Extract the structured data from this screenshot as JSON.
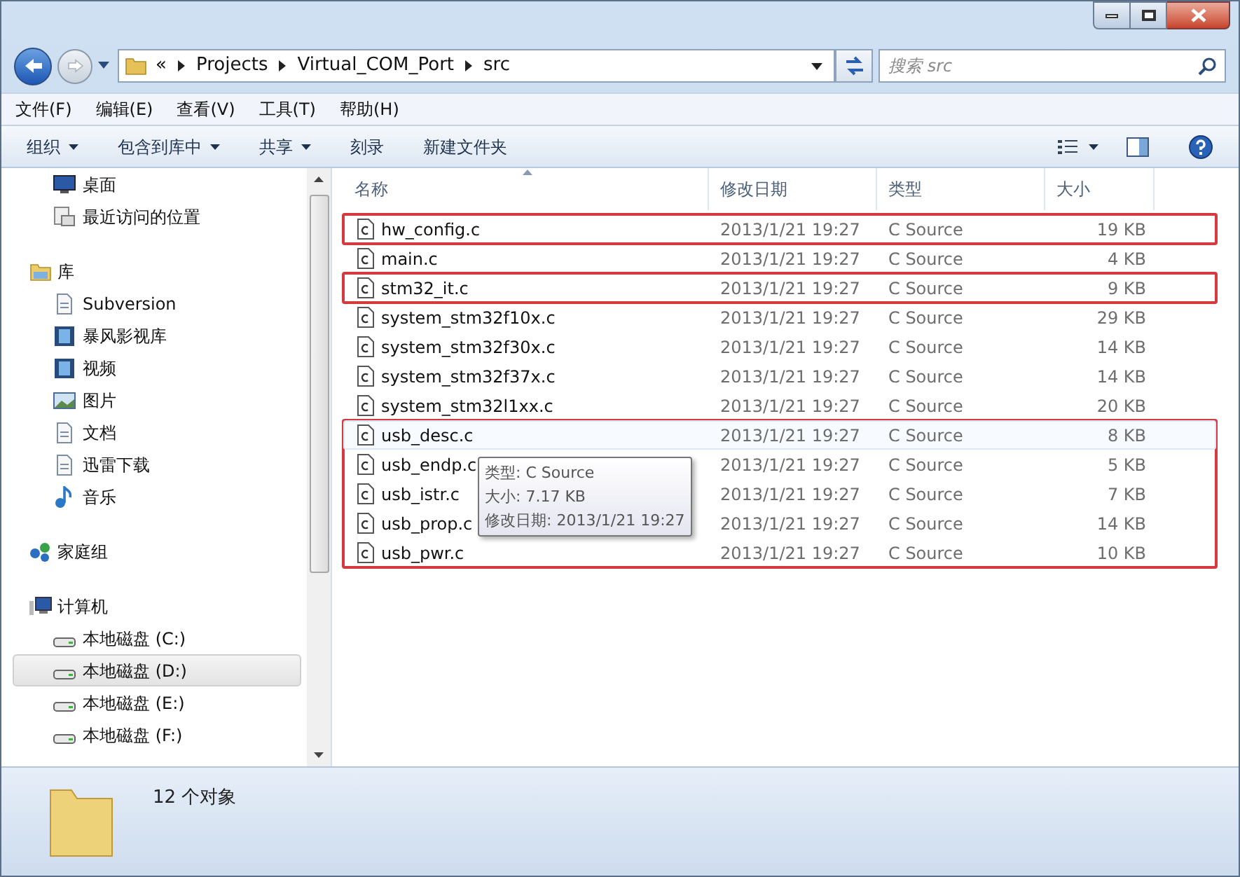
{
  "address_bar": {
    "breadcrumbs": [
      "«",
      "Projects",
      "Virtual_COM_Port",
      "src"
    ]
  },
  "search": {
    "placeholder": "搜索 src"
  },
  "menu": [
    "文件(F)",
    "编辑(E)",
    "查看(V)",
    "工具(T)",
    "帮助(H)"
  ],
  "toolbar": [
    {
      "label": "组织",
      "dropdown": true
    },
    {
      "label": "包含到库中",
      "dropdown": true
    },
    {
      "label": "共享",
      "dropdown": true
    },
    {
      "label": "刻录",
      "dropdown": false
    },
    {
      "label": "新建文件夹",
      "dropdown": false
    }
  ],
  "nav": [
    {
      "children": [
        {
          "label": "桌面",
          "kind": "desktop",
          "selected": false
        },
        {
          "label": "最近访问的位置",
          "kind": "recent",
          "selected": false
        }
      ]
    },
    {
      "label": "库",
      "kind": "library",
      "children": [
        {
          "label": "Subversion",
          "kind": "doc",
          "selected": false
        },
        {
          "label": "暴风影视库",
          "kind": "video",
          "selected": false
        },
        {
          "label": "视频",
          "kind": "video",
          "selected": false
        },
        {
          "label": "图片",
          "kind": "picture",
          "selected": false
        },
        {
          "label": "文档",
          "kind": "doc",
          "selected": false
        },
        {
          "label": "迅雷下载",
          "kind": "doc",
          "selected": false
        },
        {
          "label": "音乐",
          "kind": "music",
          "selected": false
        }
      ]
    },
    {
      "label": "家庭组",
      "kind": "homegroup"
    },
    {
      "label": "计算机",
      "kind": "computer",
      "children": [
        {
          "label": "本地磁盘 (C:)",
          "kind": "drive",
          "selected": false
        },
        {
          "label": "本地磁盘 (D:)",
          "kind": "drive",
          "selected": true
        },
        {
          "label": "本地磁盘 (E:)",
          "kind": "drive",
          "selected": false
        },
        {
          "label": "本地磁盘 (F:)",
          "kind": "drive",
          "selected": false
        }
      ]
    }
  ],
  "columns": [
    "名称",
    "修改日期",
    "类型",
    "大小"
  ],
  "file_groups": [
    {
      "outlined": true,
      "files": [
        {
          "name": "hw_config.c",
          "date": "2013/1/21 19:27",
          "type": "C Source",
          "size": "19 KB",
          "hover": false
        }
      ]
    },
    {
      "outlined": false,
      "files": [
        {
          "name": "main.c",
          "date": "2013/1/21 19:27",
          "type": "C Source",
          "size": "4 KB",
          "hover": false
        }
      ]
    },
    {
      "outlined": true,
      "files": [
        {
          "name": "stm32_it.c",
          "date": "2013/1/21 19:27",
          "type": "C Source",
          "size": "9 KB",
          "hover": false
        }
      ]
    },
    {
      "outlined": false,
      "files": [
        {
          "name": "system_stm32f10x.c",
          "date": "2013/1/21 19:27",
          "type": "C Source",
          "size": "29 KB",
          "hover": false
        },
        {
          "name": "system_stm32f30x.c",
          "date": "2013/1/21 19:27",
          "type": "C Source",
          "size": "14 KB",
          "hover": false
        },
        {
          "name": "system_stm32f37x.c",
          "date": "2013/1/21 19:27",
          "type": "C Source",
          "size": "14 KB",
          "hover": false
        },
        {
          "name": "system_stm32l1xx.c",
          "date": "2013/1/21 19:27",
          "type": "C Source",
          "size": "20 KB",
          "hover": false
        }
      ]
    },
    {
      "outlined": true,
      "files": [
        {
          "name": "usb_desc.c",
          "date": "2013/1/21 19:27",
          "type": "C Source",
          "size": "8 KB",
          "hover": true
        },
        {
          "name": "usb_endp.c",
          "date": "2013/1/21 19:27",
          "type": "C Source",
          "size": "5 KB",
          "hover": false
        },
        {
          "name": "usb_istr.c",
          "date": "2013/1/21 19:27",
          "type": "C Source",
          "size": "7 KB",
          "hover": false
        },
        {
          "name": "usb_prop.c",
          "date": "2013/1/21 19:27",
          "type": "C Source",
          "size": "14 KB",
          "hover": false
        },
        {
          "name": "usb_pwr.c",
          "date": "2013/1/21 19:27",
          "type": "C Source",
          "size": "10 KB",
          "hover": false
        }
      ]
    }
  ],
  "tooltip": [
    "类型: C Source",
    "大小: 7.17 KB",
    "修改日期: 2013/1/21 19:27"
  ],
  "status_bar": {
    "count": "12 个对象"
  }
}
